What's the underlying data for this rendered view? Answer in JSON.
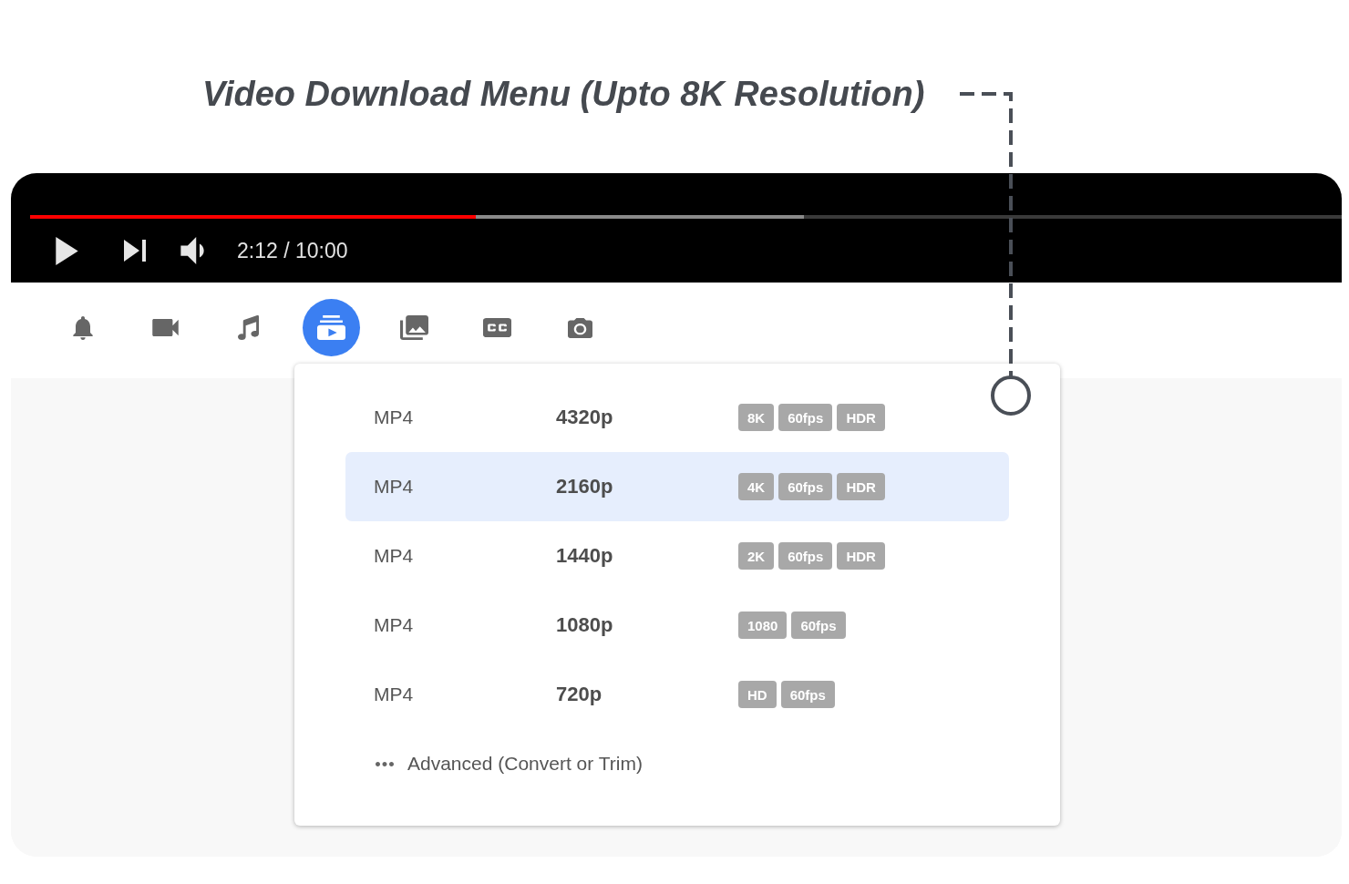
{
  "title": "Video Download Menu (Upto 8K Resolution)",
  "player": {
    "progress": {
      "played": {
        "level": 0.34
      },
      "buffered": {
        "level": 0.59
      }
    },
    "time": "2:12 / 10:00"
  },
  "toolbar": {
    "tools": [
      {
        "selected": false
      },
      {
        "selected": false
      },
      {
        "selected": false
      },
      {
        "selected": true
      },
      {
        "selected": false
      },
      {
        "selected": false
      },
      {
        "selected": false
      }
    ]
  },
  "download_menu": {
    "rows": [
      {
        "format": "MP4",
        "resolution": "4320p",
        "badges": [
          "8K",
          "60fps",
          "HDR"
        ],
        "selected": false
      },
      {
        "format": "MP4",
        "resolution": "2160p",
        "badges": [
          "4K",
          "60fps",
          "HDR"
        ],
        "selected": true
      },
      {
        "format": "MP4",
        "resolution": "1440p",
        "badges": [
          "2K",
          "60fps",
          "HDR"
        ],
        "selected": false
      },
      {
        "format": "MP4",
        "resolution": "1080p",
        "badges": [
          "1080",
          "60fps"
        ],
        "selected": false
      },
      {
        "format": "MP4",
        "resolution": "720p",
        "badges": [
          "HD",
          "60fps"
        ],
        "selected": false
      }
    ],
    "advanced": {
      "label": "Advanced (Convert or Trim)"
    }
  }
}
